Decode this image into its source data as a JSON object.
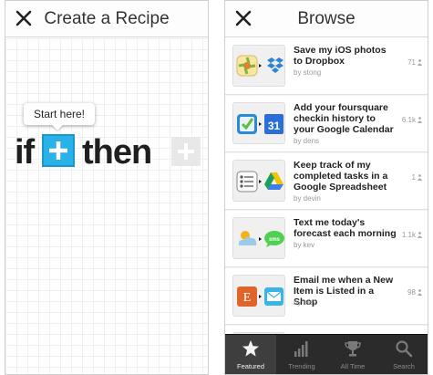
{
  "create_screen": {
    "title": "Create a Recipe",
    "tooltip": "Start here!",
    "if_word": "if",
    "then_word": "then",
    "colors": {
      "accent": "#2ab2e8",
      "inactive_plus": "#e8e8e8"
    }
  },
  "browse_screen": {
    "title": "Browse",
    "recipes": [
      {
        "title": "Save my iOS photos to Dropbox",
        "author": "by stong",
        "count": "71",
        "trigger_icon": "ios-photos-icon",
        "action_icon": "dropbox-icon"
      },
      {
        "title": "Add your foursquare checkin history to your Google Calendar",
        "author": "by dens",
        "count": "6.1k",
        "trigger_icon": "foursquare-icon",
        "action_icon": "google-calendar-icon"
      },
      {
        "title": "Keep track of my completed tasks in a Google Spreadsheet",
        "author": "by devin",
        "count": "1",
        "trigger_icon": "reminders-icon",
        "action_icon": "google-drive-icon"
      },
      {
        "title": "Text me today's forecast each morning",
        "author": "by kev",
        "count": "1.1k",
        "trigger_icon": "weather-icon",
        "action_icon": "sms-icon"
      },
      {
        "title": "Email me when a New Item is Listed in a Shop",
        "author": "by etsy",
        "count": "98",
        "trigger_icon": "etsy-icon",
        "action_icon": "email-icon"
      }
    ],
    "tabs": [
      {
        "label": "Featured",
        "icon": "star-icon",
        "active": true
      },
      {
        "label": "Trending",
        "icon": "bar-chart-icon",
        "active": false
      },
      {
        "label": "All Time",
        "icon": "trophy-icon",
        "active": false
      },
      {
        "label": "Search",
        "icon": "search-icon",
        "active": false
      }
    ]
  }
}
